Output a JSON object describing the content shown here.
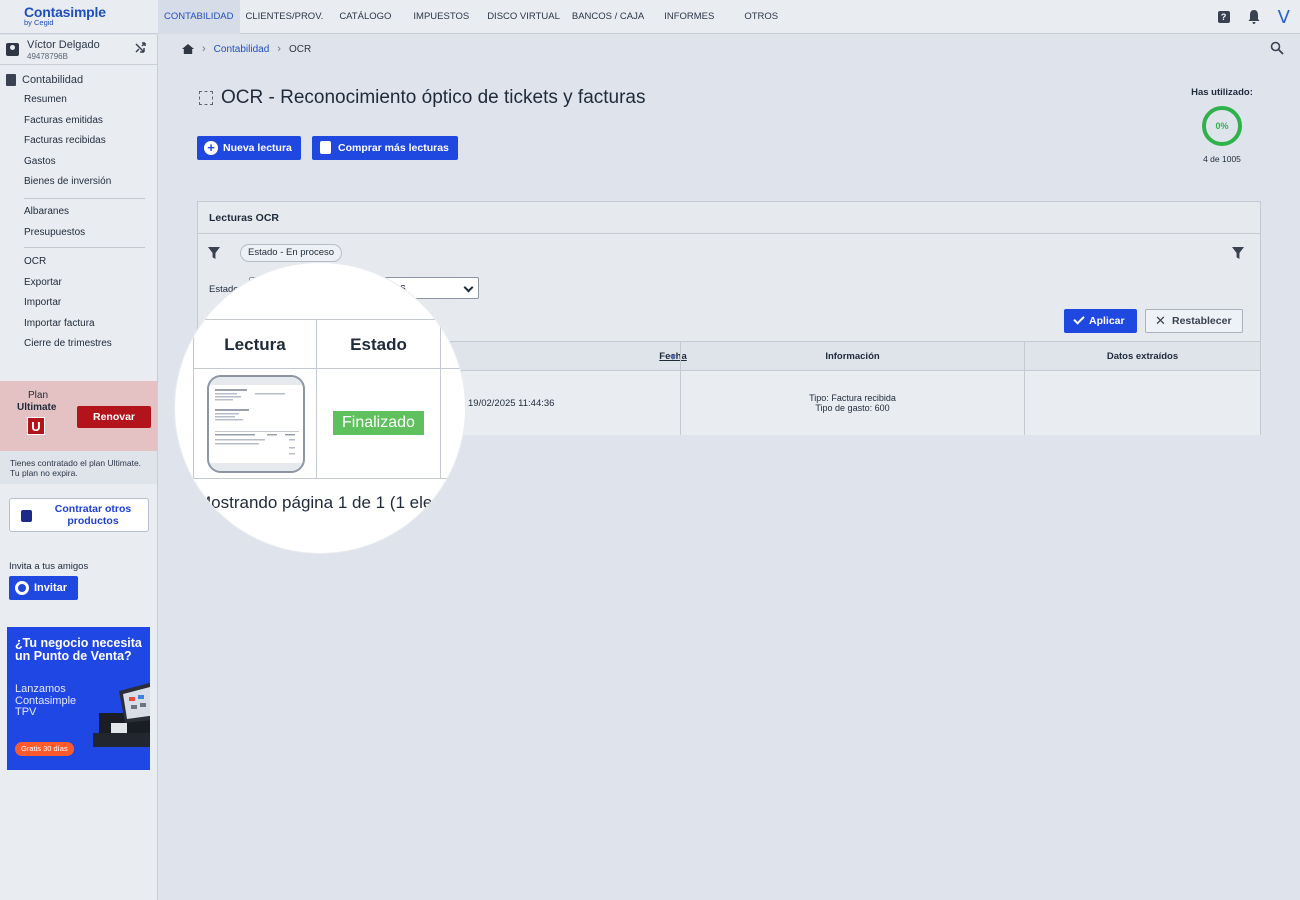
{
  "app": {
    "logo_main": "Contasimple",
    "logo_sub": "by Cegid",
    "user_initial": "V"
  },
  "nav": {
    "items": [
      {
        "label": "CONTABILIDAD",
        "active": true
      },
      {
        "label": "CLIENTES/PROV."
      },
      {
        "label": "CATÁLOGO"
      },
      {
        "label": "IMPUESTOS"
      },
      {
        "label": "DISCO VIRTUAL"
      },
      {
        "label": "BANCOS / CAJA"
      },
      {
        "label": "INFORMES"
      },
      {
        "label": "OTROS"
      }
    ]
  },
  "user": {
    "name": "Víctor Delgado",
    "nif": "49478796B"
  },
  "sidebar": {
    "section_title": "Contabilidad",
    "group1": [
      "Resumen",
      "Facturas emitidas",
      "Facturas recibidas",
      "Gastos",
      "Bienes de inversión"
    ],
    "group2": [
      "Albaranes",
      "Presupuestos"
    ],
    "group3": [
      "OCR",
      "Exportar",
      "Importar",
      "Importar factura",
      "Cierre de trimestres"
    ],
    "plan_label": "Plan",
    "plan_name": "Ultimate",
    "plan_letter": "U",
    "renew_label": "Renovar",
    "plan_info_1": "Tienes contratado el plan Ultimate.",
    "plan_info_2": "Tu plan no expira.",
    "contract_label": "Contratar otros productos",
    "invite_text": "Invita a tus amigos",
    "invite_label": "Invitar",
    "ad": {
      "title": "¿Tu negocio necesita un Punto de Venta?",
      "subtitle": "Lanzamos Contasimple TPV",
      "badge": "Gratis 30 días",
      "color": "#1f47e3"
    }
  },
  "breadcrumb": {
    "items": [
      "Contabilidad",
      "OCR"
    ]
  },
  "page": {
    "title": "OCR - Reconocimiento óptico de tickets y facturas",
    "new_reading_label": "Nueva lectura",
    "buy_more_label": "Comprar más lecturas",
    "usage_label": "Has utilizado:",
    "usage_percent": "0%",
    "usage_count": "4 de 1005"
  },
  "panel": {
    "title": "Lecturas OCR",
    "filter_chip": "Estado - En proceso",
    "estado_label": "Estado:",
    "estado_value": "dos",
    "apply_label": "Aplicar",
    "reset_label": "Restablecer",
    "columns": [
      "Lectura",
      "Estado",
      "Fecha",
      "Información",
      "Datos extraídos"
    ],
    "rows": [
      {
        "estado": "Finalizado",
        "fecha": "19/02/2025 11:44:36",
        "info_1": "Tipo: Factura recibida",
        "info_2": "Tipo de gasto: 600",
        "datos": ""
      }
    ],
    "pagination": "Mostrando página 1 de 1 (1 ele"
  },
  "colors": {
    "primary": "#1f48e0",
    "danger": "#b3141c",
    "success": "#5ec15e",
    "usage_ring": "#2fb24b"
  }
}
